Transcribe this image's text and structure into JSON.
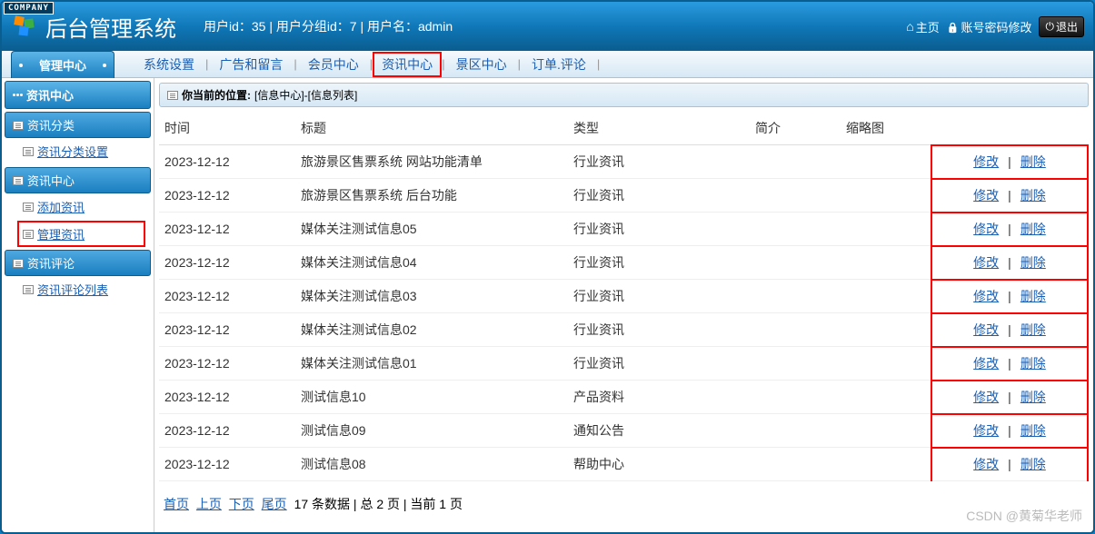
{
  "company_tag": "COMPANY",
  "header": {
    "title": "后台管理系统",
    "info": "用户id：35 | 用户分组id：7 | 用户名：admin",
    "home": "主页",
    "account": "账号密码修改",
    "logout": "退出"
  },
  "topnav": {
    "tab": "管理中心",
    "links": [
      "系统设置",
      "广告和留言",
      "会员中心",
      "资讯中心",
      "景区中心",
      "订单.评论"
    ],
    "highlighted_index": 3
  },
  "sidebar": {
    "header": "资讯中心",
    "sections": [
      {
        "title": "资讯分类",
        "items": [
          {
            "label": "资讯分类设置",
            "hl": false
          }
        ]
      },
      {
        "title": "资讯中心",
        "items": [
          {
            "label": "添加资讯",
            "hl": false
          },
          {
            "label": "管理资讯",
            "hl": true
          }
        ]
      },
      {
        "title": "资讯评论",
        "items": [
          {
            "label": "资讯评论列表",
            "hl": false
          }
        ]
      }
    ]
  },
  "breadcrumb": {
    "label": "你当前的位置:",
    "path": "[信息中心]-[信息列表]"
  },
  "table": {
    "headers": [
      "时间",
      "标题",
      "类型",
      "简介",
      "缩略图",
      ""
    ],
    "rows": [
      {
        "date": "2023-12-12",
        "title": "旅游景区售票系统 网站功能清单",
        "type": "行业资讯",
        "intro": "",
        "thumb": ""
      },
      {
        "date": "2023-12-12",
        "title": "旅游景区售票系统 后台功能",
        "type": "行业资讯",
        "intro": "",
        "thumb": ""
      },
      {
        "date": "2023-12-12",
        "title": "媒体关注测试信息05",
        "type": "行业资讯",
        "intro": "",
        "thumb": ""
      },
      {
        "date": "2023-12-12",
        "title": "媒体关注测试信息04",
        "type": "行业资讯",
        "intro": "",
        "thumb": ""
      },
      {
        "date": "2023-12-12",
        "title": "媒体关注测试信息03",
        "type": "行业资讯",
        "intro": "",
        "thumb": ""
      },
      {
        "date": "2023-12-12",
        "title": "媒体关注测试信息02",
        "type": "行业资讯",
        "intro": "",
        "thumb": ""
      },
      {
        "date": "2023-12-12",
        "title": "媒体关注测试信息01",
        "type": "行业资讯",
        "intro": "",
        "thumb": ""
      },
      {
        "date": "2023-12-12",
        "title": "测试信息10",
        "type": "产品资料",
        "intro": "",
        "thumb": ""
      },
      {
        "date": "2023-12-12",
        "title": "测试信息09",
        "type": "通知公告",
        "intro": "",
        "thumb": ""
      },
      {
        "date": "2023-12-12",
        "title": "测试信息08",
        "type": "帮助中心",
        "intro": "",
        "thumb": ""
      }
    ],
    "actions": {
      "edit": "修改",
      "delete": "删除",
      "sep": "|"
    }
  },
  "pagination": {
    "first": "首页",
    "prev": "上页",
    "next": "下页",
    "last": "尾页",
    "info": "17 条数据 | 总 2 页 | 当前 1 页"
  },
  "watermark": "CSDN @黄菊华老师"
}
